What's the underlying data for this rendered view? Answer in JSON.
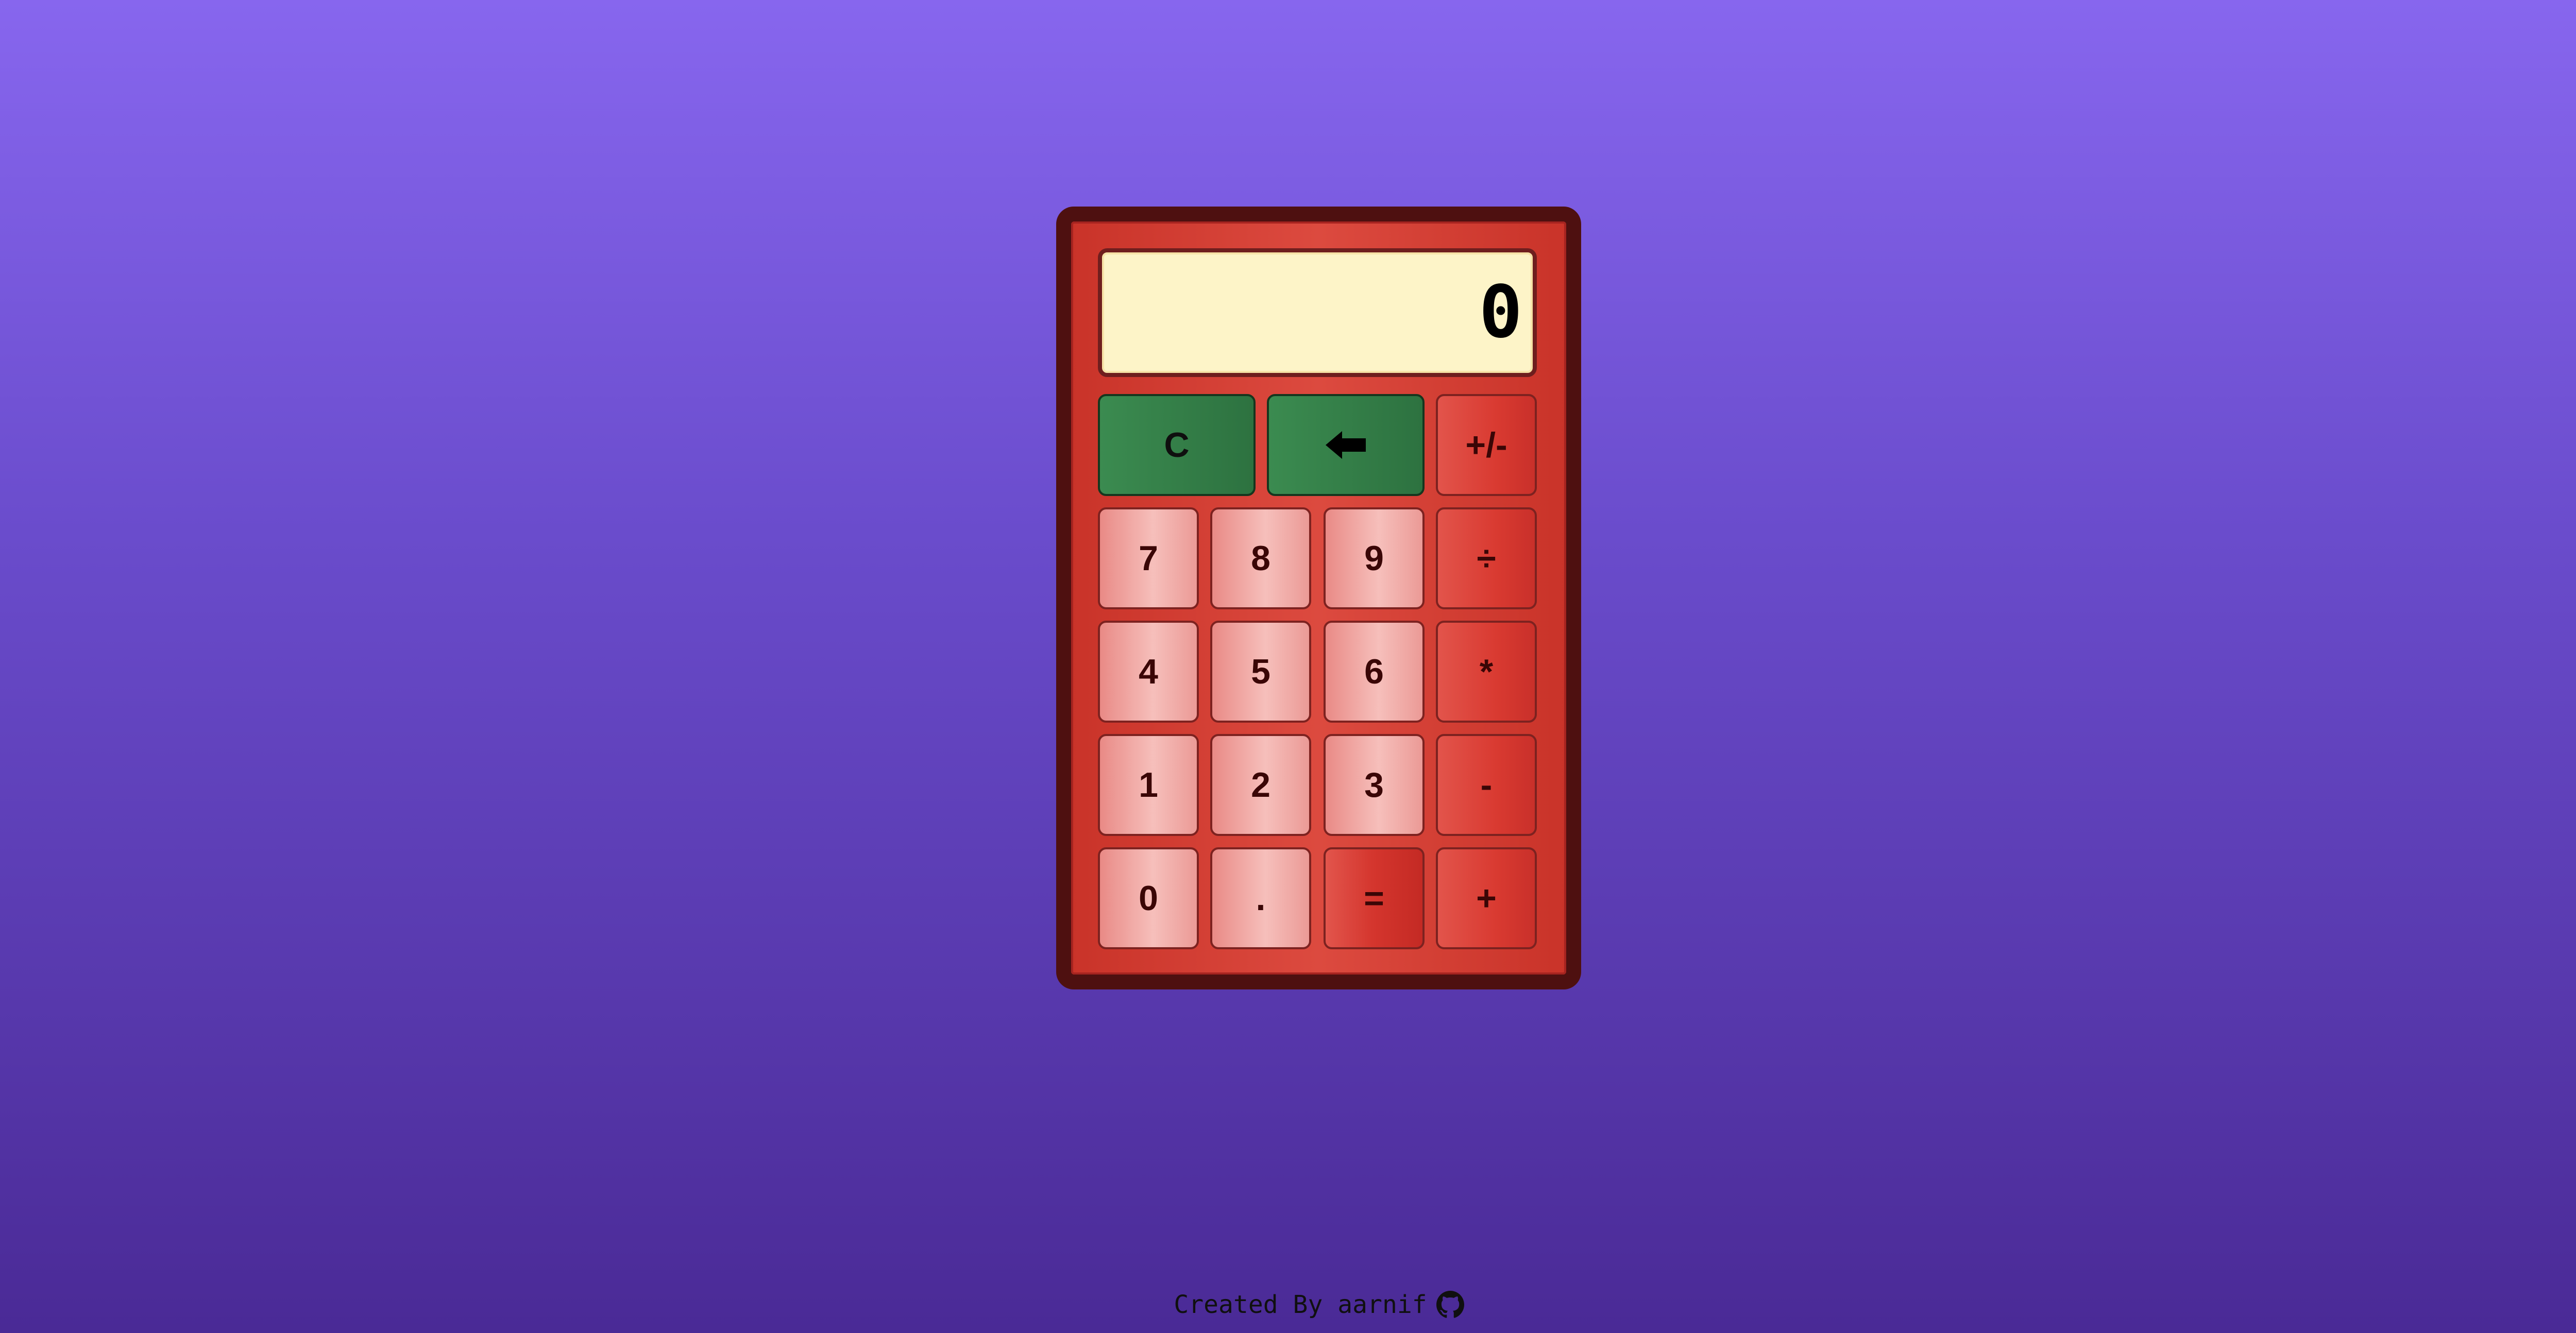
{
  "display": {
    "value": "0"
  },
  "keys": {
    "clear": "C",
    "backspace_icon": "left-arrow-icon",
    "sign": "+/-",
    "seven": "7",
    "eight": "8",
    "nine": "9",
    "divide": "÷",
    "four": "4",
    "five": "5",
    "six": "6",
    "multiply": "*",
    "one": "1",
    "two": "2",
    "three": "3",
    "minus": "-",
    "zero": "0",
    "decimal": ".",
    "equals": "=",
    "plus": "+"
  },
  "footer": {
    "text": "Created By aarnif",
    "icon": "github-icon"
  },
  "colors": {
    "background_top": "#8766ee",
    "background_bottom": "#4a2a96",
    "calculator_frame": "#4e1010",
    "calculator_body": "#d3392f",
    "display_bg": "#fdf4c8",
    "green_key": "#2f7a45",
    "number_key": "#f1aaa6",
    "operator_key": "#d93a31"
  }
}
